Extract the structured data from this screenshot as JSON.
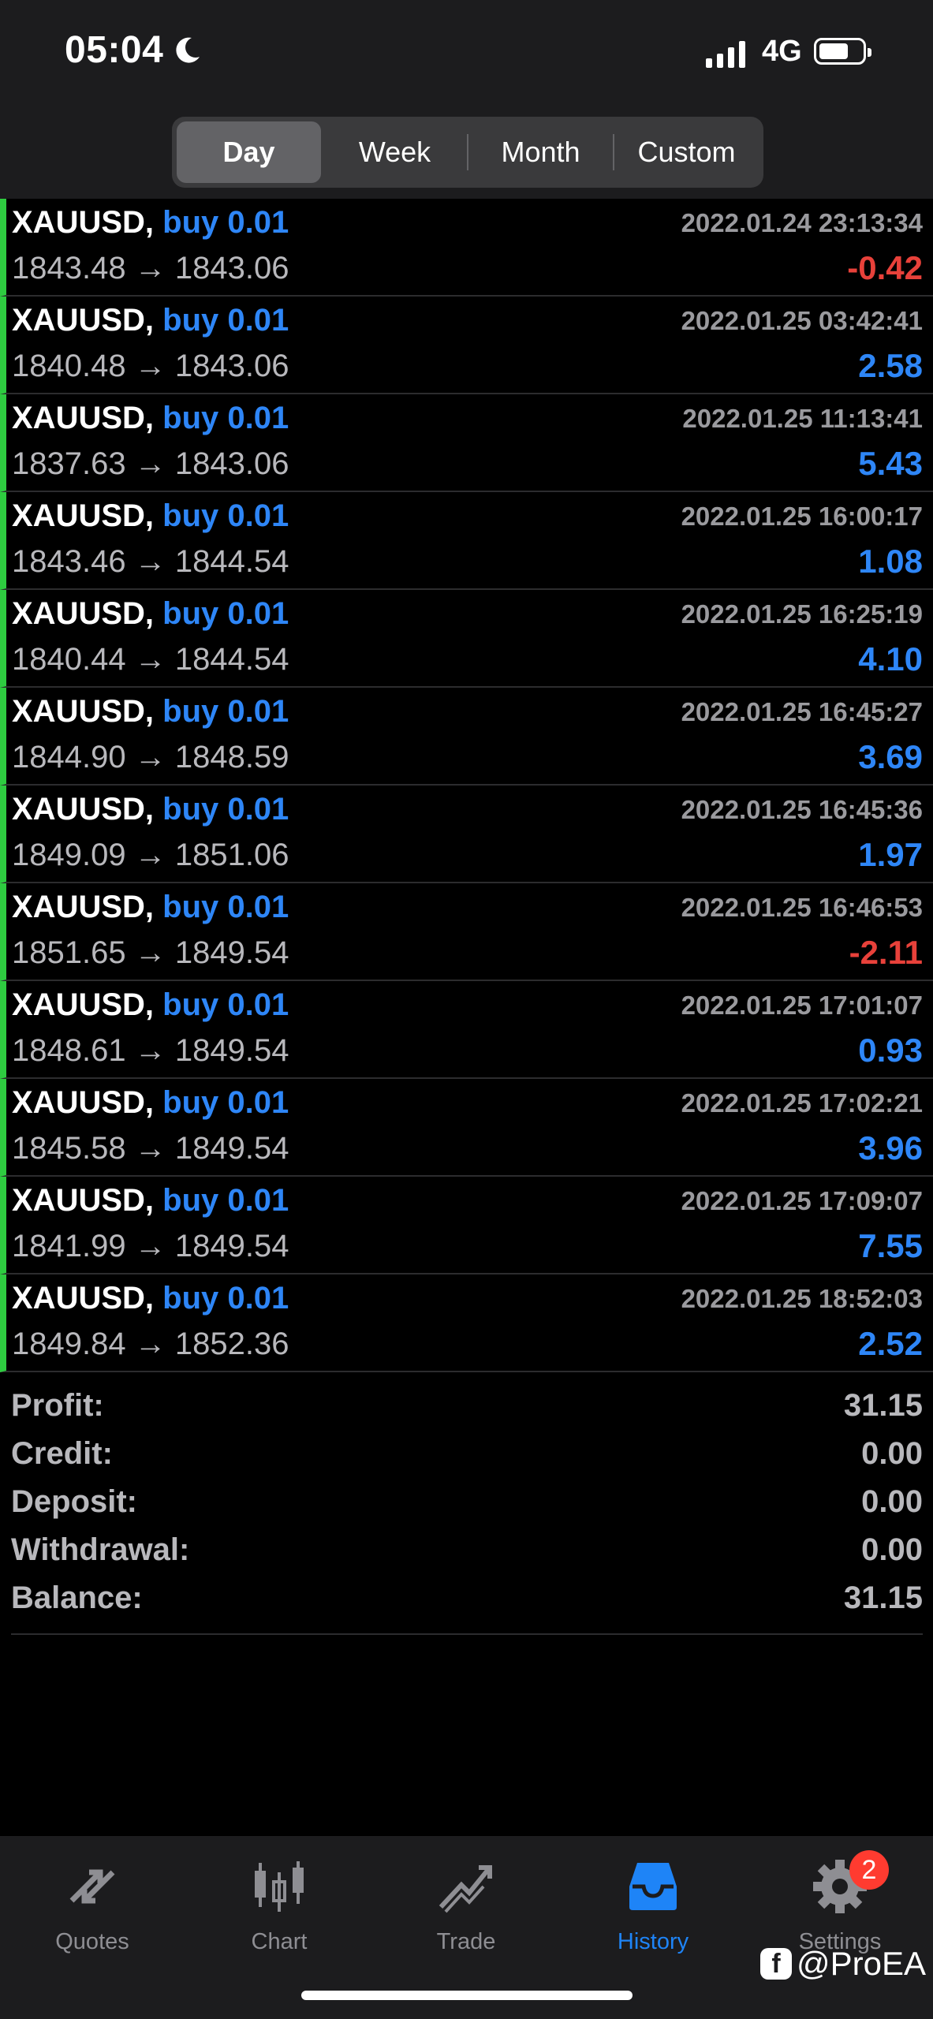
{
  "status_bar": {
    "time": "05:04",
    "network": "4G"
  },
  "segments": [
    {
      "label": "Day",
      "active": true
    },
    {
      "label": "Week",
      "active": false
    },
    {
      "label": "Month",
      "active": false
    },
    {
      "label": "Custom",
      "active": false
    }
  ],
  "deals": [
    {
      "symbol": "XAUUSD,",
      "side": "buy 0.01",
      "time": "2022.01.24 23:13:34",
      "open": "1843.48",
      "close": "1843.06",
      "profit": "-0.42"
    },
    {
      "symbol": "XAUUSD,",
      "side": "buy 0.01",
      "time": "2022.01.25 03:42:41",
      "open": "1840.48",
      "close": "1843.06",
      "profit": "2.58"
    },
    {
      "symbol": "XAUUSD,",
      "side": "buy 0.01",
      "time": "2022.01.25 11:13:41",
      "open": "1837.63",
      "close": "1843.06",
      "profit": "5.43"
    },
    {
      "symbol": "XAUUSD,",
      "side": "buy 0.01",
      "time": "2022.01.25 16:00:17",
      "open": "1843.46",
      "close": "1844.54",
      "profit": "1.08"
    },
    {
      "symbol": "XAUUSD,",
      "side": "buy 0.01",
      "time": "2022.01.25 16:25:19",
      "open": "1840.44",
      "close": "1844.54",
      "profit": "4.10"
    },
    {
      "symbol": "XAUUSD,",
      "side": "buy 0.01",
      "time": "2022.01.25 16:45:27",
      "open": "1844.90",
      "close": "1848.59",
      "profit": "3.69"
    },
    {
      "symbol": "XAUUSD,",
      "side": "buy 0.01",
      "time": "2022.01.25 16:45:36",
      "open": "1849.09",
      "close": "1851.06",
      "profit": "1.97"
    },
    {
      "symbol": "XAUUSD,",
      "side": "buy 0.01",
      "time": "2022.01.25 16:46:53",
      "open": "1851.65",
      "close": "1849.54",
      "profit": "-2.11"
    },
    {
      "symbol": "XAUUSD,",
      "side": "buy 0.01",
      "time": "2022.01.25 17:01:07",
      "open": "1848.61",
      "close": "1849.54",
      "profit": "0.93"
    },
    {
      "symbol": "XAUUSD,",
      "side": "buy 0.01",
      "time": "2022.01.25 17:02:21",
      "open": "1845.58",
      "close": "1849.54",
      "profit": "3.96"
    },
    {
      "symbol": "XAUUSD,",
      "side": "buy 0.01",
      "time": "2022.01.25 17:09:07",
      "open": "1841.99",
      "close": "1849.54",
      "profit": "7.55"
    },
    {
      "symbol": "XAUUSD,",
      "side": "buy 0.01",
      "time": "2022.01.25 18:52:03",
      "open": "1849.84",
      "close": "1852.36",
      "profit": "2.52"
    }
  ],
  "arrow": "→",
  "summary": [
    {
      "label": "Profit:",
      "value": "31.15"
    },
    {
      "label": "Credit:",
      "value": "0.00"
    },
    {
      "label": "Deposit:",
      "value": "0.00"
    },
    {
      "label": "Withdrawal:",
      "value": "0.00"
    },
    {
      "label": "Balance:",
      "value": "31.15"
    }
  ],
  "tabs": [
    {
      "label": "Quotes",
      "icon": "quotes-icon",
      "active": false
    },
    {
      "label": "Chart",
      "icon": "chart-icon",
      "active": false
    },
    {
      "label": "Trade",
      "icon": "trade-icon",
      "active": false
    },
    {
      "label": "History",
      "icon": "history-icon",
      "active": true
    },
    {
      "label": "Settings",
      "icon": "gear-icon",
      "active": false,
      "badge": "2"
    }
  ],
  "watermark": "@ProEA",
  "colors": {
    "positive": "#2e86f7",
    "negative": "#e8413a",
    "accent": "#1e84f7",
    "deal_bar": "#2ecc40"
  }
}
